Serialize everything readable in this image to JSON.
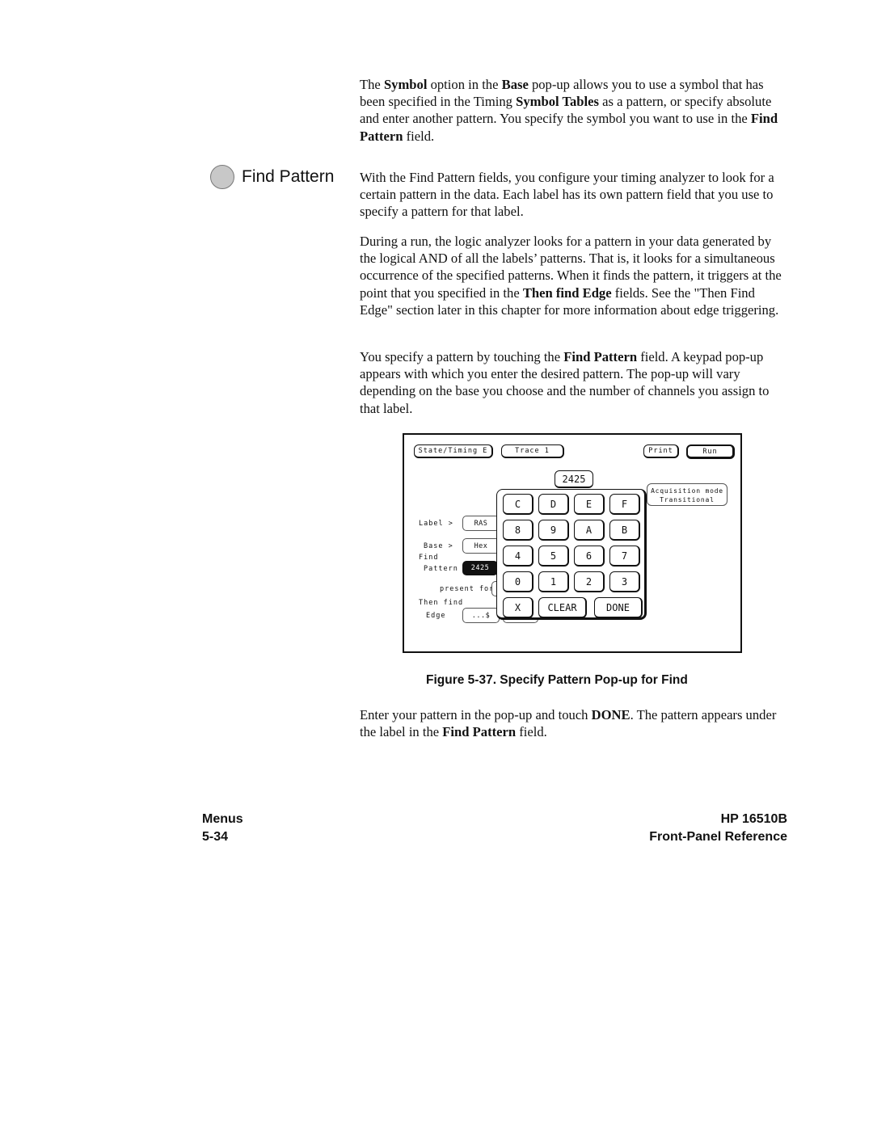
{
  "intro_paragraph": [
    {
      "t": "The ",
      "b": false
    },
    {
      "t": "Symbol",
      "b": true
    },
    {
      "t": " option in the ",
      "b": false
    },
    {
      "t": "Base",
      "b": true
    },
    {
      "t": " pop-up allows you to use a symbol that has been specified in the Timing ",
      "b": false
    },
    {
      "t": "Symbol Tables",
      "b": true
    },
    {
      "t": " as a pattern, or specify absolute and enter another pattern. You specify the symbol you want to use in the ",
      "b": false
    },
    {
      "t": "Find Pattern",
      "b": true
    },
    {
      "t": " field.",
      "b": false
    }
  ],
  "section": {
    "title": "Find Pattern",
    "paragraphs": [
      [
        {
          "t": "With the Find Pattern fields, you configure your timing analyzer to look for a certain pattern in the data. Each label has its own pattern field that you use to specify a pattern for that label.",
          "b": false
        }
      ],
      [
        {
          "t": "During a run, the logic analyzer looks for a pattern in your data generated by the logical AND of all the labels’ patterns. That is, it looks for a simultaneous occurrence of the specified patterns. When it finds the pattern, it triggers at the point that you specified in the ",
          "b": false
        },
        {
          "t": "Then find Edge",
          "b": true
        },
        {
          "t": " fields. See the \"Then Find Edge\" section later in this chapter for more information about edge triggering.",
          "b": false
        }
      ],
      [
        {
          "t": "You specify a pattern by touching the ",
          "b": false
        },
        {
          "t": "Find Pattern",
          "b": true
        },
        {
          "t": " field. A keypad pop-up appears with which you enter the desired pattern. The pop-up will vary depending on the base you choose and the number of channels you assign to that label.",
          "b": false
        }
      ]
    ]
  },
  "figure": {
    "screen": {
      "top_buttons": {
        "menu": "State/Timing E",
        "trace": "Trace 1",
        "print": "Print",
        "run": "Run"
      },
      "pattern_display": "2425",
      "acquisition": {
        "line1": "Acquisition mode",
        "line2": "Transitional"
      },
      "labels": {
        "label": "Label >",
        "base": "Base >",
        "find": "Find",
        "pattern": "Pattern",
        "present_for": "present for",
        "then_find": "Then find",
        "edge": "Edge"
      },
      "fields": {
        "label_value": "RAS",
        "base_value": "Hex",
        "pattern_value": "2425",
        "edge_value": "...$"
      },
      "keypad": {
        "rows": [
          [
            "C",
            "D",
            "E",
            "F"
          ],
          [
            "8",
            "9",
            "A",
            "B"
          ],
          [
            "4",
            "5",
            "6",
            "7"
          ],
          [
            "0",
            "1",
            "2",
            "3"
          ]
        ],
        "x": "X",
        "clear": "CLEAR",
        "done": "DONE"
      }
    },
    "caption": "Figure 5-37. Specify Pattern Pop-up for Find"
  },
  "closing_paragraph": [
    {
      "t": "Enter your pattern in the pop-up and touch ",
      "b": false
    },
    {
      "t": "DONE",
      "b": true
    },
    {
      "t": ". The pattern appears under the label in the ",
      "b": false
    },
    {
      "t": "Find Pattern",
      "b": true
    },
    {
      "t": " field.",
      "b": false
    }
  ],
  "footer": {
    "left_top": "Menus",
    "left_bottom": "5-34",
    "right_top": "HP 16510B",
    "right_bottom": "Front-Panel Reference"
  }
}
